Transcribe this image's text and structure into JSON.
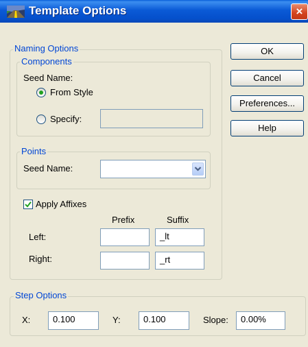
{
  "window": {
    "title": "Template Options",
    "close_glyph": "×"
  },
  "naming_options": {
    "legend": "Naming Options",
    "components": {
      "legend": "Components",
      "seed_name_label": "Seed Name:",
      "from_style_label": "From Style",
      "from_style_selected": true,
      "specify_label": "Specify:",
      "specify_value": ""
    },
    "points": {
      "legend": "Points",
      "seed_name_label": "Seed Name:",
      "seed_name_value": ""
    },
    "apply_affixes": {
      "label": "Apply Affixes",
      "checked": true,
      "prefix_header": "Prefix",
      "suffix_header": "Suffix",
      "left_label": "Left:",
      "left_prefix": "",
      "left_suffix": "_lt",
      "right_label": "Right:",
      "right_prefix": "",
      "right_suffix": "_rt"
    }
  },
  "buttons": {
    "ok": "OK",
    "cancel": "Cancel",
    "preferences": "Preferences...",
    "help": "Help"
  },
  "step_options": {
    "legend": "Step Options",
    "x_label": "X:",
    "x_value": "0.100",
    "y_label": "Y:",
    "y_value": "0.100",
    "slope_label": "Slope:",
    "slope_value": "0.00%"
  },
  "colors": {
    "titlebar": "#0b5ad6",
    "dialog_bg": "#ece9d8",
    "group_legend": "#0046d5",
    "close_button": "#d4431e"
  },
  "icons": {
    "title": "template-road-icon",
    "close": "close-icon",
    "dropdown": "chevron-down-icon",
    "check": "checkmark-icon"
  }
}
